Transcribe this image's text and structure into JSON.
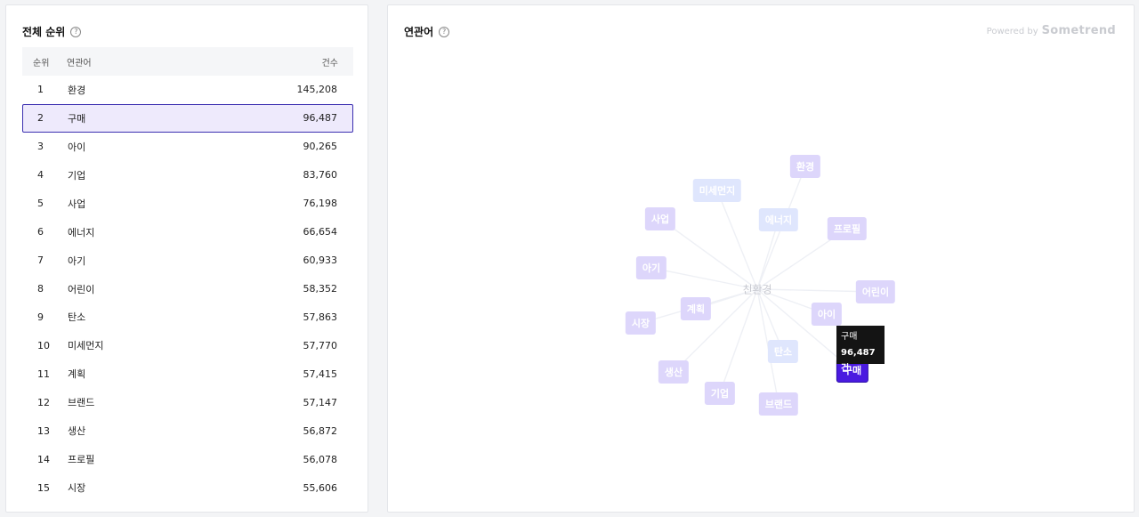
{
  "left_panel": {
    "title": "전체 순위",
    "help_icon": "question-circle-icon",
    "headers": {
      "rank": "순위",
      "word": "연관어",
      "count": "건수"
    },
    "rows": [
      {
        "rank": "1",
        "word": "환경",
        "count": "145,208"
      },
      {
        "rank": "2",
        "word": "구매",
        "count": "96,487",
        "selected": true
      },
      {
        "rank": "3",
        "word": "아이",
        "count": "90,265"
      },
      {
        "rank": "4",
        "word": "기업",
        "count": "83,760"
      },
      {
        "rank": "5",
        "word": "사업",
        "count": "76,198"
      },
      {
        "rank": "6",
        "word": "에너지",
        "count": "66,654"
      },
      {
        "rank": "7",
        "word": "아기",
        "count": "60,933"
      },
      {
        "rank": "8",
        "word": "어린이",
        "count": "58,352"
      },
      {
        "rank": "9",
        "word": "탄소",
        "count": "57,863"
      },
      {
        "rank": "10",
        "word": "미세먼지",
        "count": "57,770"
      },
      {
        "rank": "11",
        "word": "계획",
        "count": "57,415"
      },
      {
        "rank": "12",
        "word": "브랜드",
        "count": "57,147"
      },
      {
        "rank": "13",
        "word": "생산",
        "count": "56,872"
      },
      {
        "rank": "14",
        "word": "프로필",
        "count": "56,078"
      },
      {
        "rank": "15",
        "word": "시장",
        "count": "55,606"
      }
    ]
  },
  "right_panel": {
    "title": "연관어",
    "help_icon": "question-circle-icon",
    "powered_prefix": "Powered by",
    "powered_brand": "Sometrend",
    "center_word": "친환경",
    "nodes": [
      {
        "word": "환경",
        "style": "purple"
      },
      {
        "word": "미세먼지",
        "style": "blue"
      },
      {
        "word": "사업",
        "style": "purple"
      },
      {
        "word": "에너지",
        "style": "blue"
      },
      {
        "word": "프로필",
        "style": "purple"
      },
      {
        "word": "아기",
        "style": "purple"
      },
      {
        "word": "어린이",
        "style": "purple"
      },
      {
        "word": "계획",
        "style": "purple"
      },
      {
        "word": "아이",
        "style": "purple"
      },
      {
        "word": "시장",
        "style": "purple"
      },
      {
        "word": "탄소",
        "style": "blue"
      },
      {
        "word": "생산",
        "style": "purple"
      },
      {
        "word": "구매",
        "style": "active"
      },
      {
        "word": "기업",
        "style": "purple"
      },
      {
        "word": "브랜드",
        "style": "purple"
      }
    ],
    "tooltip": {
      "word": "구매",
      "count": "96,487건"
    },
    "colors": {
      "active": "#4a1ae0",
      "purple_node": "#ddd6fb",
      "blue_node": "#dfe6fd",
      "selected_row": "#eeeafc"
    }
  }
}
